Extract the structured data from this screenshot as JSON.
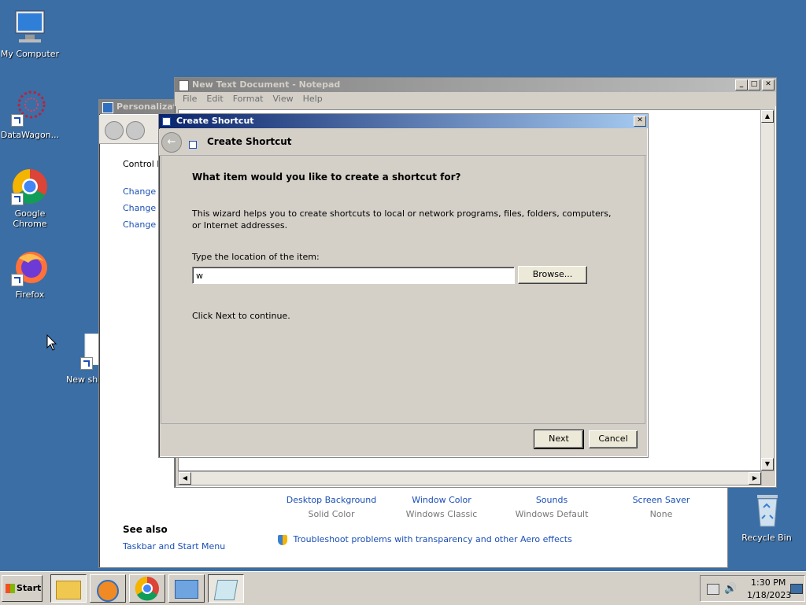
{
  "desktop": {
    "icons": [
      {
        "label": "My Computer",
        "icon": "computer-icon"
      },
      {
        "label": "DataWagon...",
        "icon": "datawagon-icon"
      },
      {
        "label": "Google Chrome",
        "icon": "chrome-icon"
      },
      {
        "label": "Firefox",
        "icon": "firefox-icon"
      },
      {
        "label": "New sho",
        "icon": "new-shortcut-icon"
      },
      {
        "label": "Recycle Bin",
        "icon": "recycle-bin-icon"
      }
    ]
  },
  "notepad": {
    "title": "New Text Document - Notepad",
    "menu": [
      "File",
      "Edit",
      "Format",
      "View",
      "Help"
    ]
  },
  "personalization": {
    "title": "Personalizati",
    "links": [
      "Control P",
      "Change d",
      "Change m",
      "Change y"
    ],
    "see_also": "See also",
    "taskbar_link": "Taskbar and Start Menu",
    "items": [
      {
        "label": "Desktop Background",
        "value": "Solid Color"
      },
      {
        "label": "Window Color",
        "value": "Windows Classic"
      },
      {
        "label": "Sounds",
        "value": "Windows Default"
      },
      {
        "label": "Screen Saver",
        "value": "None"
      }
    ],
    "troubleshoot": "Troubleshoot problems with transparency and other Aero effects"
  },
  "wizard": {
    "title": "Create Shortcut",
    "header": "Create Shortcut",
    "question": "What item would you like to create a shortcut for?",
    "description": "This wizard helps you to create shortcuts to local or network programs, files, folders, computers, or Internet addresses.",
    "location_label": "Type the location of the item:",
    "location_value": "w",
    "browse_label": "Browse...",
    "continue_text": "Click Next to continue.",
    "next_label": "Next",
    "cancel_label": "Cancel"
  },
  "taskbar": {
    "start_label": "Start",
    "time": "1:30 PM",
    "date": "1/18/2023"
  },
  "colors": {
    "desktop": "#3a6ea5",
    "active_title": "#0a246a",
    "link": "#1a4fb5"
  }
}
